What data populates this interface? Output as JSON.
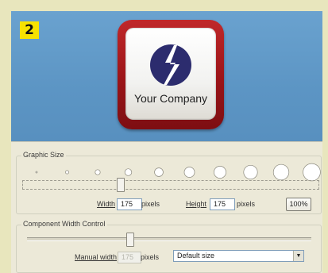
{
  "step_badge": "2",
  "logo": {
    "company_name": "Your Company",
    "frame_color": "#a8181c",
    "mark_color": "#2c2c6e"
  },
  "graphic_size": {
    "group_label": "Graphic Size",
    "width_label": "Width",
    "width_value": "175",
    "width_unit": "pixels",
    "height_label": "Height",
    "height_value": "175",
    "height_unit": "pixels",
    "percent_button": "100%",
    "slider_fraction": 0.33
  },
  "component_width": {
    "group_label": "Component Width Control",
    "manual_label": "Manual width",
    "manual_value": "175",
    "manual_unit": "pixels",
    "size_select": "Default size",
    "slider_fraction": 0.36
  }
}
